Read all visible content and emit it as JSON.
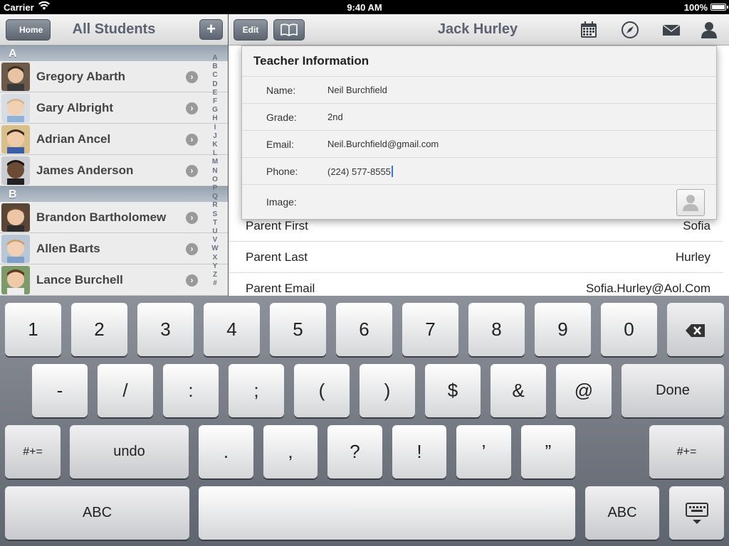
{
  "status": {
    "carrier": "Carrier",
    "time": "9:40 AM",
    "battery": "100%"
  },
  "left": {
    "home_label": "Home",
    "title": "All Students",
    "add_label": "+",
    "sections": [
      {
        "letter": "A",
        "students": [
          "Gregory Abarth",
          "Gary Albright",
          "Adrian Ancel",
          "James Anderson"
        ]
      },
      {
        "letter": "B",
        "students": [
          "Brandon Bartholomew",
          "Allen Barts",
          "Lance Burchell"
        ]
      }
    ],
    "index": [
      "A",
      "B",
      "C",
      "D",
      "E",
      "F",
      "G",
      "H",
      "I",
      "J",
      "K",
      "L",
      "M",
      "N",
      "O",
      "P",
      "Q",
      "R",
      "S",
      "T",
      "U",
      "V",
      "W",
      "X",
      "Y",
      "Z",
      "#"
    ]
  },
  "right": {
    "edit_label": "Edit",
    "title": "Jack Hurley",
    "rows": [
      {
        "key": "Parent First",
        "value": "Sofia"
      },
      {
        "key": "Parent Last",
        "value": "Hurley"
      },
      {
        "key": "Parent Email",
        "value": "Sofia.Hurley@Aol.Com"
      }
    ]
  },
  "popover": {
    "title": "Teacher Information",
    "fields": [
      {
        "key": "Name:",
        "value": "Neil Burchfield"
      },
      {
        "key": "Grade:",
        "value": "2nd"
      },
      {
        "key": "Email:",
        "value": "Neil.Burchfield@gmail.com"
      },
      {
        "key": "Phone:",
        "value": "(224) 577-8555"
      },
      {
        "key": "Image:",
        "value": ""
      }
    ]
  },
  "keyboard": {
    "row1": [
      "1",
      "2",
      "3",
      "4",
      "5",
      "6",
      "7",
      "8",
      "9",
      "0"
    ],
    "row2": [
      "-",
      "/",
      ":",
      ";",
      "(",
      ")",
      "$",
      "&",
      "@"
    ],
    "done": "Done",
    "row3": [
      ".",
      ",",
      "?",
      "!",
      "’",
      "”"
    ],
    "alt": "#+=",
    "undo": "undo",
    "abc": "ABC"
  },
  "colors": {
    "accent": "#5b6470",
    "section": "#a7b2bd",
    "cursor": "#3b6ee8"
  }
}
